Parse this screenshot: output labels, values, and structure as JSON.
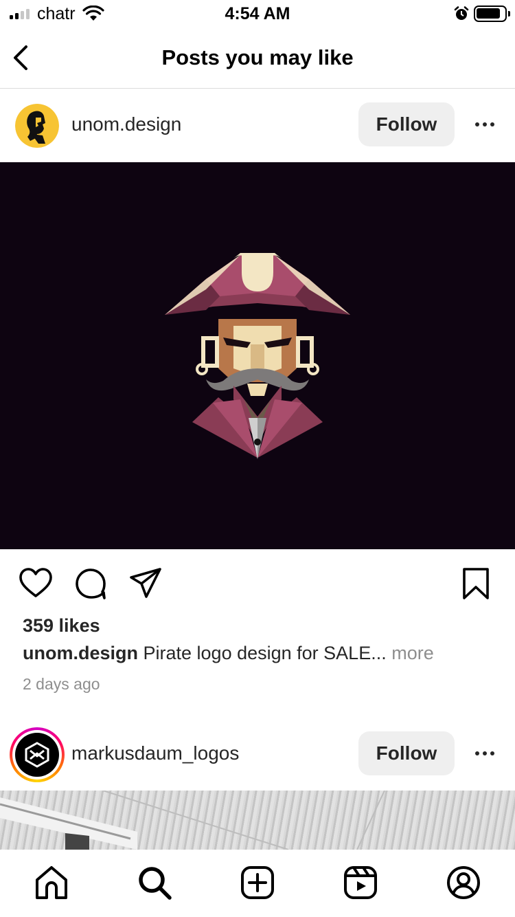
{
  "status_bar": {
    "carrier": "chatr",
    "time": "4:54 AM"
  },
  "header": {
    "title": "Posts you may like"
  },
  "posts": [
    {
      "username": "unom.design",
      "follow_label": "Follow",
      "likes": "359 likes",
      "caption_user": "unom.design",
      "caption_text": " Pirate logo design for SALE...",
      "caption_more": " more",
      "time_ago": "2 days ago"
    },
    {
      "username": "markusdaum_logos",
      "follow_label": "Follow"
    }
  ],
  "icons": {
    "back": "chevron-left-icon",
    "like": "heart-icon",
    "comment": "comment-icon",
    "share": "send-icon",
    "save": "bookmark-icon",
    "tabs": [
      "home-icon",
      "search-icon",
      "add-post-icon",
      "reels-icon",
      "profile-icon"
    ]
  },
  "colors": {
    "media_background": "#0e0411",
    "follow_button": "#efefef",
    "secondary_text": "#8e8e8e"
  }
}
